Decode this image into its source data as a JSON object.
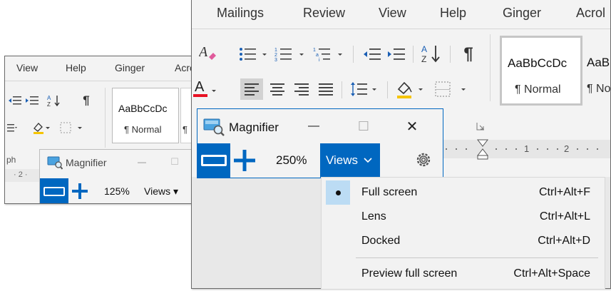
{
  "back_window": {
    "tabs": [
      "View",
      "Help",
      "Ginger",
      "Acro"
    ],
    "style_preview": "AaBbCcDc",
    "style_label": "¶ Normal",
    "style_label_partial": "¶",
    "left_edge_text": "ph",
    "ruler_text": "· 2 ·",
    "magnifier": {
      "title": "Magnifier",
      "zoom": "125%",
      "views_label": "Views ▾",
      "minimize": "—",
      "maximize": "☐",
      "close": "✕"
    }
  },
  "front_window": {
    "tabs": [
      "Mailings",
      "Review",
      "View",
      "Help",
      "Ginger",
      "Acrol"
    ],
    "style_preview_1": "AaBbCcDc",
    "style_label_1": "¶ Normal",
    "style_preview_2": "AaB",
    "style_label_2": "¶ No",
    "ruler_numbers": [
      "1",
      "2"
    ],
    "magnifier": {
      "title": "Magnifier",
      "zoom": "250%",
      "views_label": "Views",
      "minimize": "—",
      "maximize": "☐",
      "close": "✕"
    },
    "views_menu": [
      {
        "label": "Full screen",
        "shortcut": "Ctrl+Alt+F",
        "selected": true
      },
      {
        "label": "Lens",
        "shortcut": "Ctrl+Alt+L",
        "selected": false
      },
      {
        "label": "Docked",
        "shortcut": "Ctrl+Alt+D",
        "selected": false
      },
      {
        "label": "Preview full screen",
        "shortcut": "Ctrl+Alt+Space",
        "selected": false
      }
    ]
  },
  "colors": {
    "accent_blue": "#0067c0",
    "selected_highlight": "#cce4f7",
    "menu_bullet_bg": "#bcdcf4",
    "font_color_red": "#e81123"
  }
}
